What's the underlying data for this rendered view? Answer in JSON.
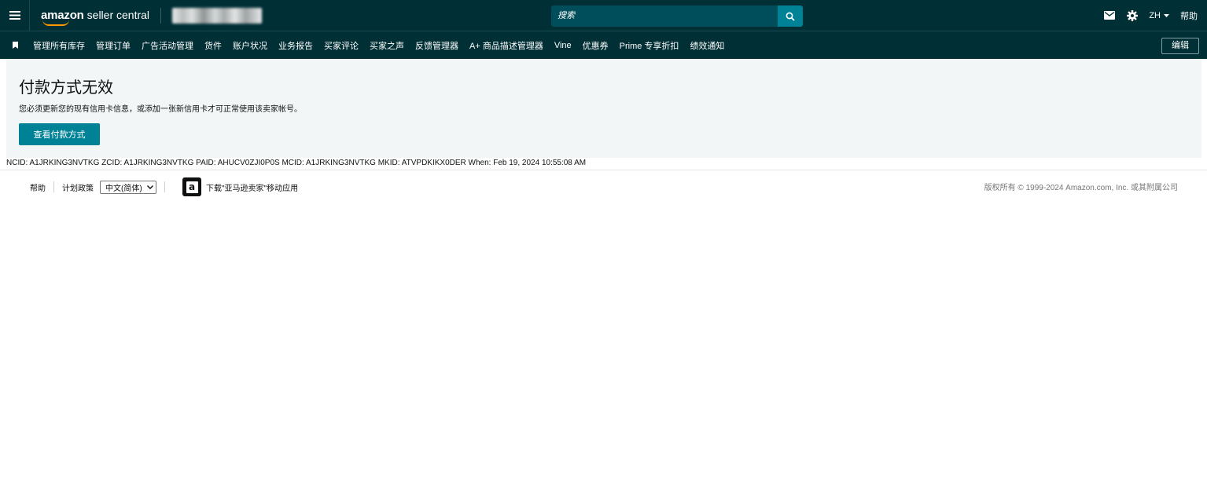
{
  "header": {
    "brand": "amazon",
    "product": "seller central",
    "search_placeholder": "搜索",
    "lang": "ZH",
    "help": "帮助"
  },
  "nav": {
    "items": [
      "管理所有库存",
      "管理订单",
      "广告活动管理",
      "货件",
      "账户状况",
      "业务报告",
      "买家评论",
      "买家之声",
      "反馈管理器",
      "A+ 商品描述管理器",
      "Vine",
      "优惠券",
      "Prime 专享折扣",
      "绩效通知"
    ],
    "edit": "编辑"
  },
  "alert": {
    "title": "付款方式无效",
    "message": "您必须更新您的现有信用卡信息，或添加一张新信用卡才可正常使用该卖家帐号。",
    "button": "查看付款方式"
  },
  "ids_text": "NCID: A1JRKING3NVTKG ZCID: A1JRKING3NVTKG PAID: AHUCV0ZJI0P0S MCID: A1JRKING3NVTKG MKID: ATVPDKIKX0DER When: Feb 19, 2024 10:55:08 AM",
  "footer": {
    "help": "帮助",
    "policies": "计划政策",
    "language_selected": "中文(简体)",
    "app_download": "下载\"亚马逊卖家\"移动应用",
    "copyright": "版权所有 © 1999-2024 Amazon.com, Inc. 或其附属公司"
  },
  "icons": {
    "menu": "hamburger-icon",
    "search": "search-icon",
    "mail": "mail-icon",
    "settings": "gear-icon",
    "bookmark": "bookmark-icon"
  },
  "colors": {
    "header_bg": "#002f36",
    "search_bg": "#004e5b",
    "accent": "#008296",
    "alert_bg": "#f3f6f6"
  }
}
